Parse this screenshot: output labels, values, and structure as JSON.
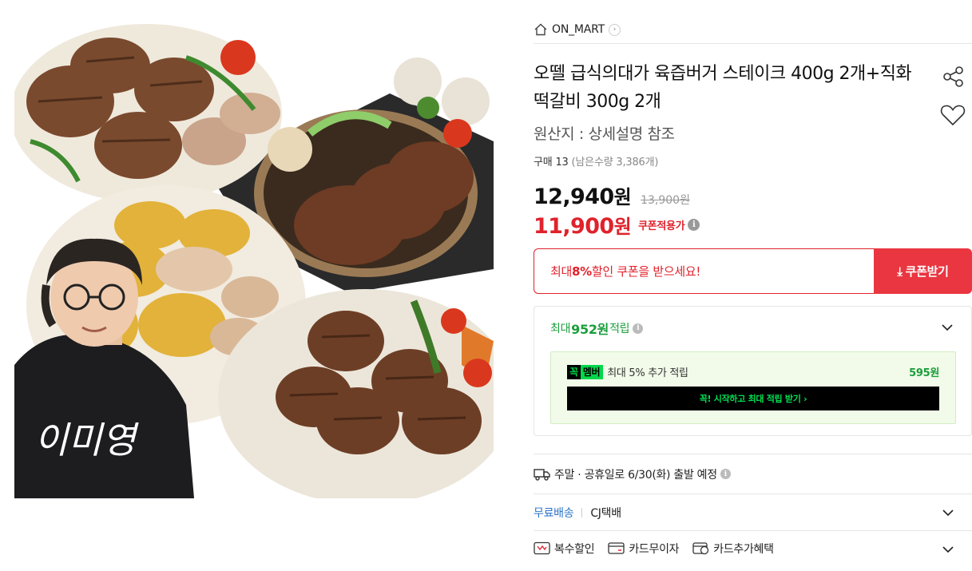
{
  "store": {
    "name": "ON_MART"
  },
  "product": {
    "title": "오뗄 급식의대가 육즙버거 스테이크 400g 2개+직화 떡갈비 300g 2개",
    "origin": "원산지 : 상세설명 참조",
    "purchase_count": "구매 13",
    "remaining": "(남은수량 3,386개)",
    "image_signature": "이미영"
  },
  "price": {
    "sale": "12,940",
    "won": "원",
    "original": "13,900원",
    "coupon_price": "11,900",
    "coupon_applied_label": "쿠폰적용가"
  },
  "coupon": {
    "msg_prefix": "최대 ",
    "msg_percent": "8%",
    "msg_suffix": " 할인 쿠폰을 받으세요!",
    "button_label": "쿠폰받기"
  },
  "points": {
    "prefix": "최대 ",
    "amount": "952원",
    "suffix": " 적립",
    "member_badge_k": "꼭",
    "member_badge": "멤버",
    "member_text": "최대 5% 추가 적립",
    "member_amount": "595원",
    "member_cta": "꼭! 시작하고 최대 적립 받기 ›"
  },
  "delivery": {
    "text": "주말 · 공휴일로 6/30(화) 출발 예정"
  },
  "shipping": {
    "free": "무료배송",
    "carrier": "CJ택배"
  },
  "benefits": [
    {
      "label": "복수할인"
    },
    {
      "label": "카드무이자"
    },
    {
      "label": "카드추가혜택"
    }
  ],
  "colors": {
    "accent_red": "#e0222c",
    "coupon_button": "#e93640",
    "point_green": "#1a9e3b",
    "member_green": "#00d84a",
    "free_ship_blue": "#2b73c7"
  }
}
